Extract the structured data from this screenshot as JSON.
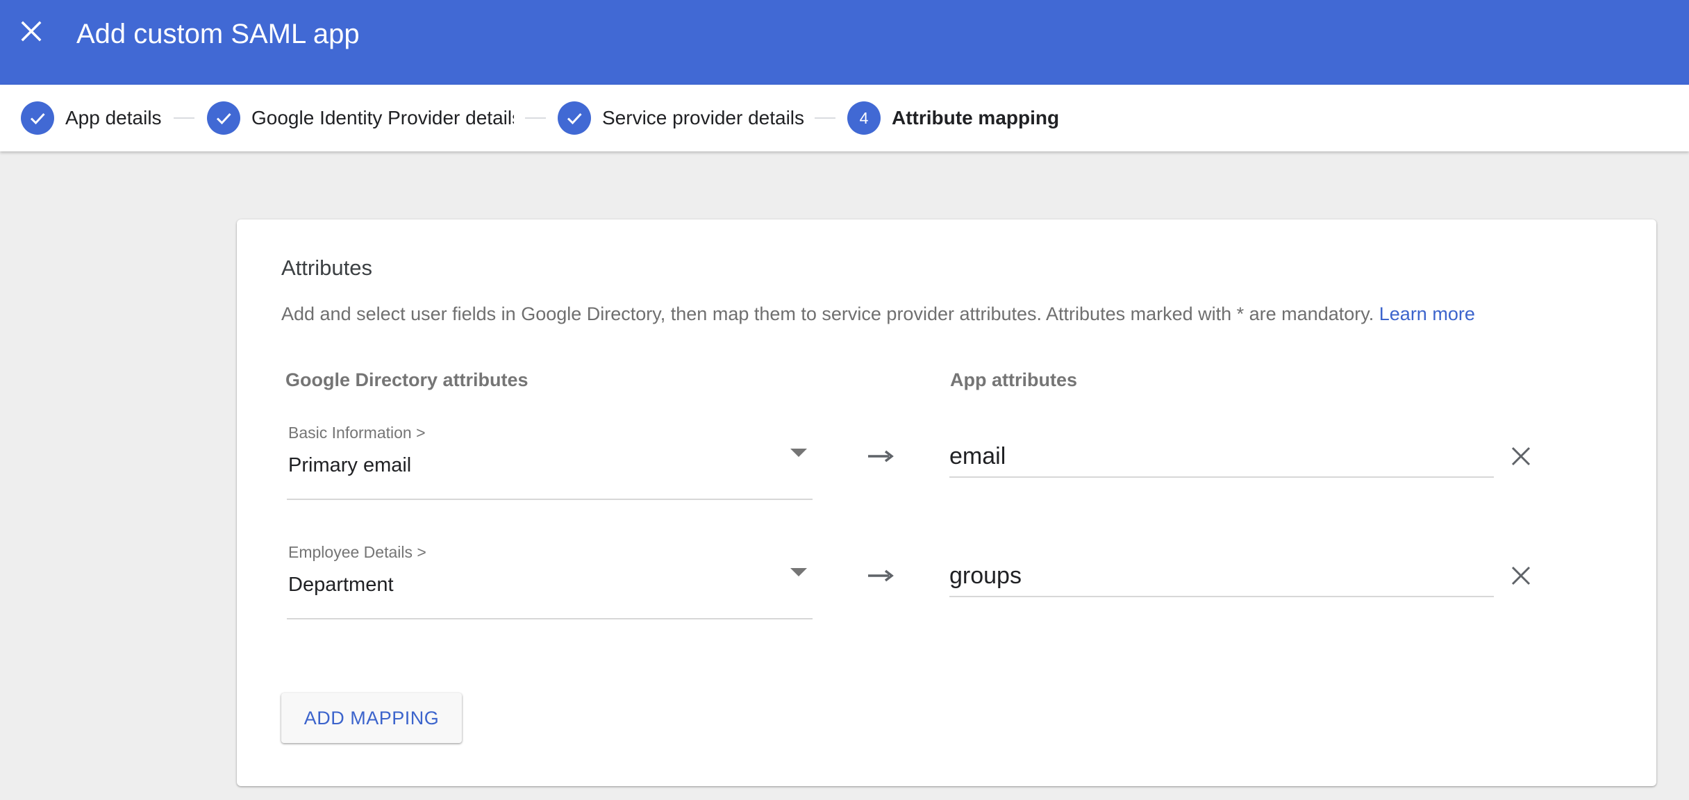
{
  "header": {
    "title": "Add custom SAML app",
    "close_icon": "close-icon"
  },
  "stepper": {
    "steps": [
      {
        "label": "App details",
        "state": "completed",
        "marker": ""
      },
      {
        "label": "Google Identity Provider details",
        "state": "completed",
        "marker": ""
      },
      {
        "label": "Service provider details",
        "state": "completed",
        "marker": ""
      },
      {
        "label": "Attribute mapping",
        "state": "active",
        "marker": "4"
      }
    ]
  },
  "attributes": {
    "title": "Attributes",
    "description": "Add and select user fields in Google Directory, then map them to service provider attributes. Attributes marked with * are mandatory.",
    "learn_more": "Learn more",
    "google_col_header": "Google Directory attributes",
    "app_col_header": "App attributes",
    "mappings": [
      {
        "category": "Basic Information >",
        "field": "Primary email",
        "app_attribute": "email"
      },
      {
        "category": "Employee Details >",
        "field": "Department",
        "app_attribute": "groups"
      }
    ],
    "add_mapping_label": "ADD MAPPING"
  },
  "colors": {
    "brand_blue": "#4169d4",
    "link_blue": "#3c64cc",
    "background": "#eeeeee"
  }
}
